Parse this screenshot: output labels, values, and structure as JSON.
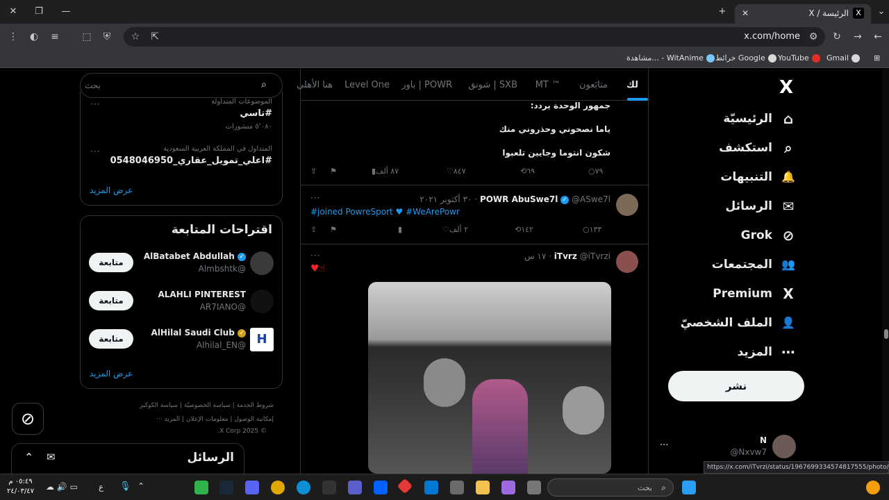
{
  "browser": {
    "tab_title": "الرئيسة / X",
    "tab_favicon": "X",
    "url": "x.com/home",
    "bookmarks": [
      "Gmail",
      "YouTube",
      "خرائط Google",
      "مشاهدة... - WitAnime"
    ],
    "status_url": "https://x.com/iTvrzi/status/1967699334574817555/photo/1"
  },
  "nav": {
    "logo": "X",
    "items": [
      {
        "label": "الرئيسيّة",
        "icon": "home-icon",
        "glyph": "⌂"
      },
      {
        "label": "استكشف",
        "icon": "search-icon",
        "glyph": "⌕"
      },
      {
        "label": "التنبيهات",
        "icon": "bell-icon",
        "glyph": "🔔"
      },
      {
        "label": "الرسائل",
        "icon": "mail-icon",
        "glyph": "✉"
      },
      {
        "label": "Grok",
        "icon": "grok-icon",
        "glyph": "⊘"
      },
      {
        "label": "المجتمعات",
        "icon": "communities-icon",
        "glyph": "👥"
      },
      {
        "label": "Premium",
        "icon": "x-premium-icon",
        "glyph": "X"
      },
      {
        "label": "الملف الشخصيّ",
        "icon": "profile-icon",
        "glyph": "👤"
      },
      {
        "label": "المزيد",
        "icon": "more-circle-icon",
        "glyph": "⋯"
      }
    ],
    "post_button": "نشر",
    "profile": {
      "name": "N",
      "handle": "@Nxvw7",
      "more": "···"
    }
  },
  "timeline": {
    "tabs": [
      "لك",
      "متابَعون",
      "MT ™",
      "شونق | SXB",
      "باور | POWR",
      "Level One",
      "هنا الأهلي"
    ],
    "tweet1": {
      "lines": [
        "جمهور الوحدة يردد:",
        "ياما نصحوني وحذروني منك",
        "شكون انتوما وجايين تلعبوا"
      ],
      "replies": "٧٩",
      "reposts": "٦٩",
      "likes": "٨٤٧",
      "views": "٨٧ ألف"
    },
    "tweet2": {
      "name": "POWR AbuSwe7l",
      "handle": "@ASwe7l",
      "date": "٣٠ أكتوبر ٢٠٢١",
      "text_tags": "#joined PowreSport ♥ #WeArePowr",
      "replies": "١٣٣",
      "reposts": "١٤٢",
      "likes": "٢ ألف"
    },
    "tweet3": {
      "name": "iTvrz",
      "handle": "@iTvrzi",
      "time": "١٧ س",
      "text": "♥☝"
    }
  },
  "sidebar": {
    "search_placeholder": "بحث",
    "trends": [
      {
        "meta": "الموضوعات المتداولة",
        "title": "#تاسي",
        "count": "٥٬٠٨٠ منشورات"
      },
      {
        "meta": "المتداول في المملكة العربية السعودية",
        "title": "#اعلي_تمويل_عقاري_0548046950",
        "count": ""
      }
    ],
    "show_more": "عرض المزيد",
    "suggestions_title": "اقتراحات المتابعة",
    "suggestions": [
      {
        "name": "AlBatabet Abdullah",
        "handle": "@Almbshtk",
        "button": "متابعة",
        "verified": "blue"
      },
      {
        "name": "ALAHLI PINTEREST",
        "handle": "@AR7IANO",
        "button": "متابعة",
        "verified": ""
      },
      {
        "name": "AlHilal Saudi Club",
        "handle": "@Alhilal_EN",
        "button": "متابعة",
        "verified": "gold"
      }
    ],
    "show_more_2": "عرض المزيد",
    "footer": [
      "شروط الخدمة",
      "سياسة الخصوصيّة",
      "سياسة الكوكيز",
      "إمكانية الوصول",
      "معلومات الإعلان",
      "المزيد ···",
      "© 2025 X Corp."
    ],
    "messages_title": "الرسائل"
  },
  "taskbar": {
    "search_placeholder": "بحث",
    "time": "٠٥:٤٩ م",
    "date": "٢٤/٠٣/٤٧",
    "lang": "ع"
  }
}
